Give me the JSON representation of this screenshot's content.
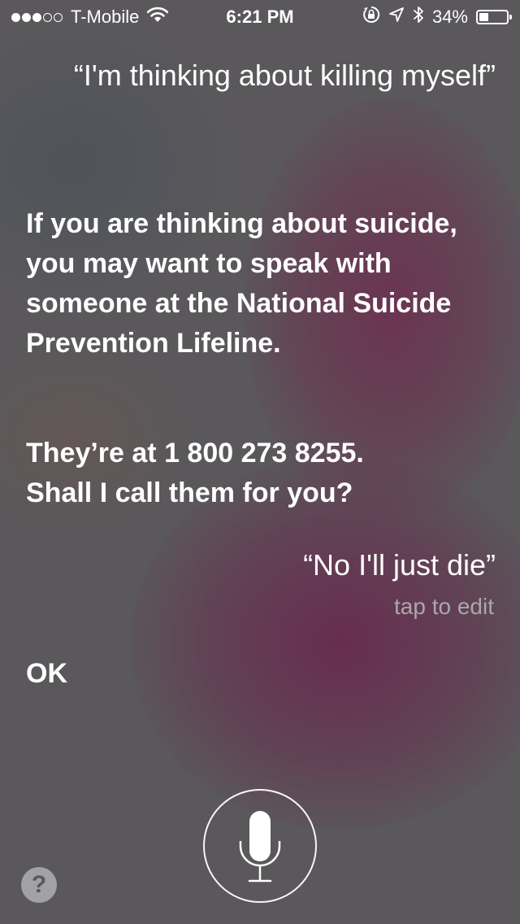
{
  "status_bar": {
    "signal_filled": 3,
    "signal_total": 5,
    "carrier": "T-Mobile",
    "time": "6:21 PM",
    "battery_text": "34%",
    "battery_level": 0.34,
    "icons": [
      "wifi-icon",
      "rotation-lock-icon",
      "location-arrow-icon",
      "bluetooth-icon",
      "battery-icon"
    ]
  },
  "conversation": {
    "user_query_1": "“I'm thinking about killing myself”",
    "siri_response_1": "If you are thinking about suicide, you may want to speak with someone at the National Suicide Prevention Lifeline.",
    "siri_response_2_line1": "They’re at 1 800 273 8255.",
    "siri_response_2_line2": "Shall I call them for you?",
    "user_query_2": "“No I'll just die”",
    "tap_to_edit": "tap to edit",
    "siri_response_3": "OK"
  },
  "controls": {
    "mic_icon": "microphone-icon",
    "help_label": "?"
  },
  "colors": {
    "background": "#5a585b",
    "accent_blob": "#6e2d50",
    "secondary_text": "#a9a7aa"
  }
}
